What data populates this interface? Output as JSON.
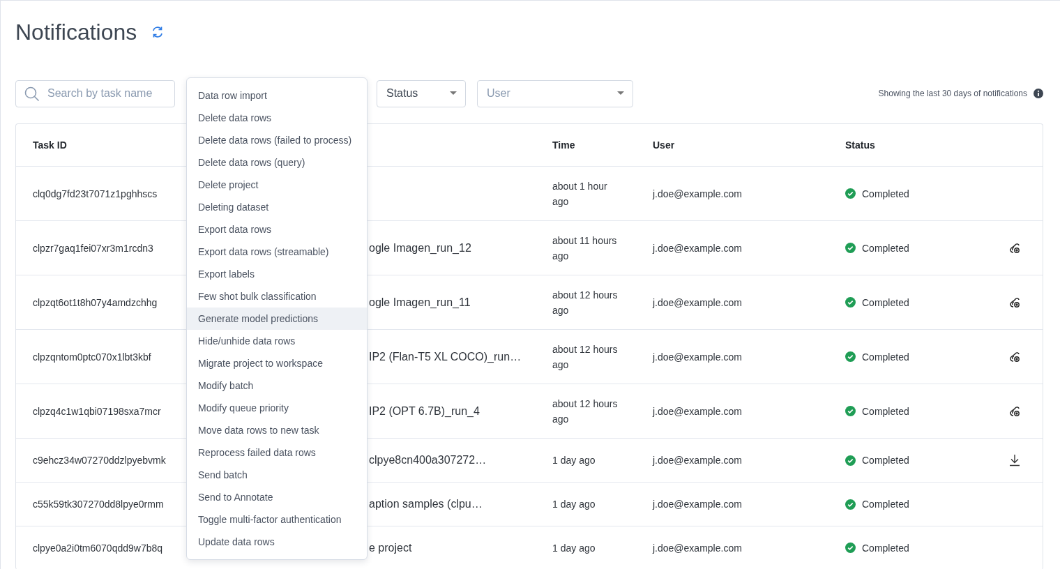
{
  "title": "Notifications",
  "filters": {
    "search": {
      "placeholder": "Search by task name"
    },
    "status": {
      "value": "Status"
    },
    "user": {
      "placeholder": "User"
    }
  },
  "info_text": "Showing the last 30 days of notifications",
  "table": {
    "columns": [
      "Task ID",
      "Time",
      "User",
      "Status"
    ],
    "rows": [
      {
        "task_id": "clq0dg7fd23t7071z1pghhscs",
        "name": "",
        "time": "about 1 hour ago",
        "user": "j.doe@example.com",
        "status": "Completed",
        "kind": "plain"
      },
      {
        "task_id": "clpzr7gaq1fei07xr3m1rcdn3",
        "name": "ogle Imagen_run_12",
        "time": "about 11 hours ago",
        "user": "j.doe@example.com",
        "status": "Completed",
        "kind": "model"
      },
      {
        "task_id": "clpzqt6ot1t8h07y4amdzchhg",
        "name": "ogle Imagen_run_11",
        "time": "about 12 hours ago",
        "user": "j.doe@example.com",
        "status": "Completed",
        "kind": "model"
      },
      {
        "task_id": "clpzqntom0ptc070x1lbt3kbf",
        "name": "IP2 (Flan-T5 XL COCO)_run…",
        "time": "about 12 hours ago",
        "user": "j.doe@example.com",
        "status": "Completed",
        "kind": "model"
      },
      {
        "task_id": "clpzq4c1w1qbi07198sxa7mcr",
        "name": "IP2 (OPT 6.7B)_run_4",
        "time": "about 12 hours ago",
        "user": "j.doe@example.com",
        "status": "Completed",
        "kind": "model"
      },
      {
        "task_id": "c9ehcz34w07270ddzlpyebvmk",
        "name": "clpye8cn400a307272…",
        "time": "1 day ago",
        "user": "j.doe@example.com",
        "status": "Completed",
        "kind": "download"
      },
      {
        "task_id": "c55k59tk307270dd8lpye0rmm",
        "name": "aption samples (clpu…",
        "time": "1 day ago",
        "user": "j.doe@example.com",
        "status": "Completed",
        "kind": "plain"
      },
      {
        "task_id": "clpye0a2i0tm6070qdd9w7b8q",
        "name": "e project",
        "time": "1 day ago",
        "user": "j.doe@example.com",
        "status": "Completed",
        "kind": "plain"
      }
    ]
  },
  "task_type_menu": [
    {
      "label": "Data row import",
      "selected": false
    },
    {
      "label": "Delete data rows",
      "selected": false
    },
    {
      "label": "Delete data rows (failed to process)",
      "selected": false
    },
    {
      "label": "Delete data rows (query)",
      "selected": false
    },
    {
      "label": "Delete project",
      "selected": false
    },
    {
      "label": "Deleting dataset",
      "selected": false
    },
    {
      "label": "Export data rows",
      "selected": false
    },
    {
      "label": "Export data rows (streamable)",
      "selected": false
    },
    {
      "label": "Export labels",
      "selected": false
    },
    {
      "label": "Few shot bulk classification",
      "selected": false
    },
    {
      "label": "Generate model predictions",
      "selected": true
    },
    {
      "label": "Hide/unhide data rows",
      "selected": false
    },
    {
      "label": "Migrate project to workspace",
      "selected": false
    },
    {
      "label": "Modify batch",
      "selected": false
    },
    {
      "label": "Modify queue priority",
      "selected": false
    },
    {
      "label": "Move data rows to new task",
      "selected": false
    },
    {
      "label": "Reprocess failed data rows",
      "selected": false
    },
    {
      "label": "Send batch",
      "selected": false
    },
    {
      "label": "Send to Annotate",
      "selected": false
    },
    {
      "label": "Toggle multi-factor authentication",
      "selected": false
    },
    {
      "label": "Update data rows",
      "selected": false
    }
  ]
}
